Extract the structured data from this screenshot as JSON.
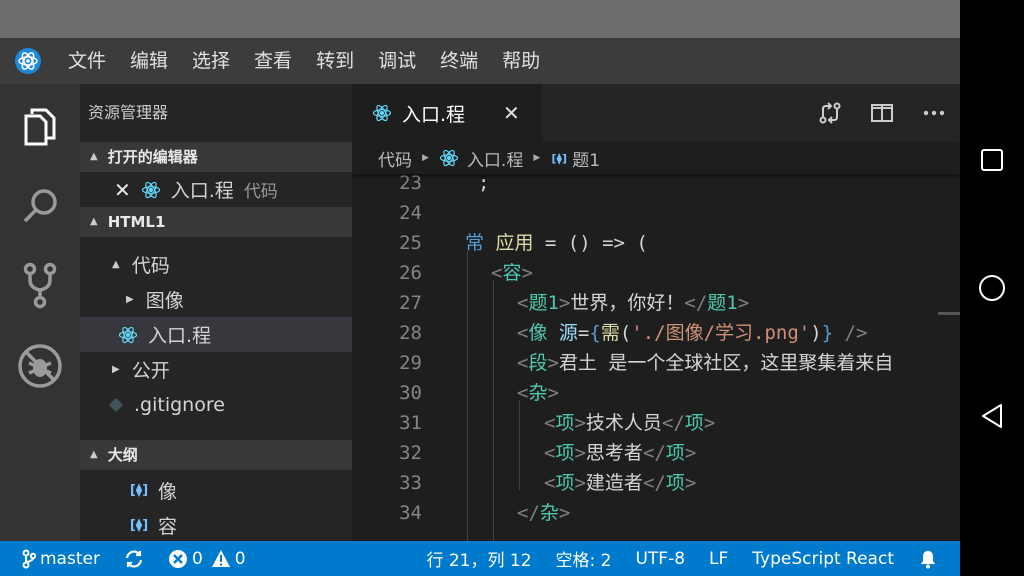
{
  "menubar": {
    "items": [
      "文件",
      "编辑",
      "选择",
      "查看",
      "转到",
      "调试",
      "终端",
      "帮助"
    ]
  },
  "activitybar": {
    "icons": [
      "files-icon",
      "search-icon",
      "source-control-icon",
      "debug-icon"
    ]
  },
  "sidebar": {
    "title": "资源管理器",
    "open_editors": {
      "header": "打开的编辑器",
      "items": [
        {
          "name": "入口.程",
          "desc": "代码"
        }
      ]
    },
    "project": {
      "header": "HTML1",
      "tree": [
        {
          "label": "代码",
          "kind": "folder-open"
        },
        {
          "label": "图像",
          "kind": "folder-closed"
        },
        {
          "label": "入口.程",
          "kind": "file-react",
          "selected": true
        },
        {
          "label": "公开",
          "kind": "folder-closed"
        },
        {
          "label": ".gitignore",
          "kind": "file-git"
        }
      ]
    },
    "outline": {
      "header": "大纲",
      "items": [
        "像",
        "容"
      ]
    }
  },
  "editor": {
    "tab": {
      "label": "入口.程"
    },
    "breadcrumb": [
      "代码",
      "入口.程",
      "题1"
    ],
    "lines": [
      {
        "n": "23",
        "text": ";"
      },
      {
        "n": "24",
        "text": ""
      },
      {
        "n": "25",
        "k": "常",
        "f": "应用",
        "rest": " = () => ("
      },
      {
        "n": "26",
        "o": "<",
        "t": "容",
        "c": ">"
      },
      {
        "n": "27",
        "o": "<",
        "t": "题1",
        "c": ">",
        "body": "世界，你好！",
        "o2": "</",
        "t2": "题1",
        "c2": ">"
      },
      {
        "n": "28",
        "o": "<",
        "t": "像",
        "a": " 源",
        "eq": "=",
        "b1": "{",
        "f": "需",
        "p1": "(",
        "s": "'./图像/学习.png'",
        "p2": ")",
        "b2": "}",
        "end": " />"
      },
      {
        "n": "29",
        "o": "<",
        "t": "段",
        "c": ">",
        "body": "君土 是一个全球社区，这里聚集着来自"
      },
      {
        "n": "30",
        "o": "<",
        "t": "杂",
        "c": ">"
      },
      {
        "n": "31",
        "o": "<",
        "t": "项",
        "c": ">",
        "body": "技术人员",
        "o2": "</",
        "t2": "项",
        "c2": ">"
      },
      {
        "n": "32",
        "o": "<",
        "t": "项",
        "c": ">",
        "body": "思考者",
        "o2": "</",
        "t2": "项",
        "c2": ">"
      },
      {
        "n": "33",
        "o": "<",
        "t": "项",
        "c": ">",
        "body": "建造者",
        "o2": "</",
        "t2": "项",
        "c2": ">"
      },
      {
        "n": "34",
        "o": "</",
        "t": "杂",
        "c": ">"
      }
    ]
  },
  "statusbar": {
    "branch": "master",
    "errors": "0",
    "warnings": "0",
    "position": "行 21，列 12",
    "spaces": "空格: 2",
    "encoding": "UTF-8",
    "eol": "LF",
    "language": "TypeScript React"
  },
  "colors": {
    "statusbar": "#007acc",
    "menubar": "#3c3c3c",
    "activitybar": "#333333",
    "sidebar": "#252526",
    "editor": "#1e1e1e"
  }
}
